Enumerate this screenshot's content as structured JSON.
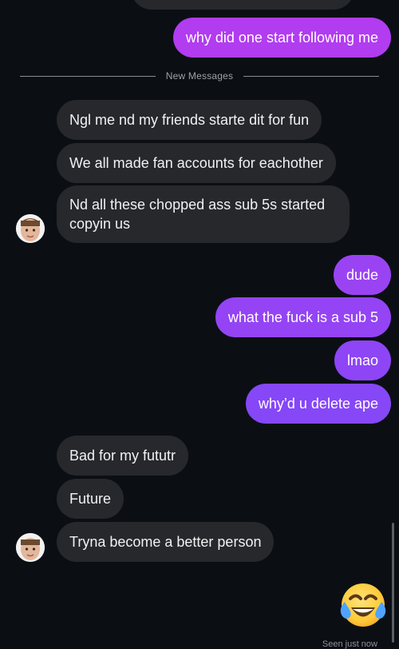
{
  "divider": {
    "label": "New Messages"
  },
  "messages": {
    "m0": "why did one start following me",
    "m1": "Ngl me nd my friends starte dit for fun",
    "m2": "We all made fan accounts for eachother",
    "m3": "Nd all these chopped ass sub 5s started copyin us",
    "m4": "dude",
    "m5": "what the fuck is a sub 5",
    "m6": "lmao",
    "m7": "why’d u delete ape",
    "m8": "Bad for my fututr",
    "m9": "Future",
    "m10": "Tryna become a better person"
  },
  "reaction": {
    "emoji_name": "tears-of-joy-emoji"
  },
  "status": {
    "seen": "Seen just now"
  },
  "colors": {
    "background": "#0b0f14",
    "incoming_bubble": "#26282c",
    "outgoing_top": "#b13cf0",
    "outgoing_mid": "#9a43f3",
    "outgoing_low": "#8647f7"
  }
}
